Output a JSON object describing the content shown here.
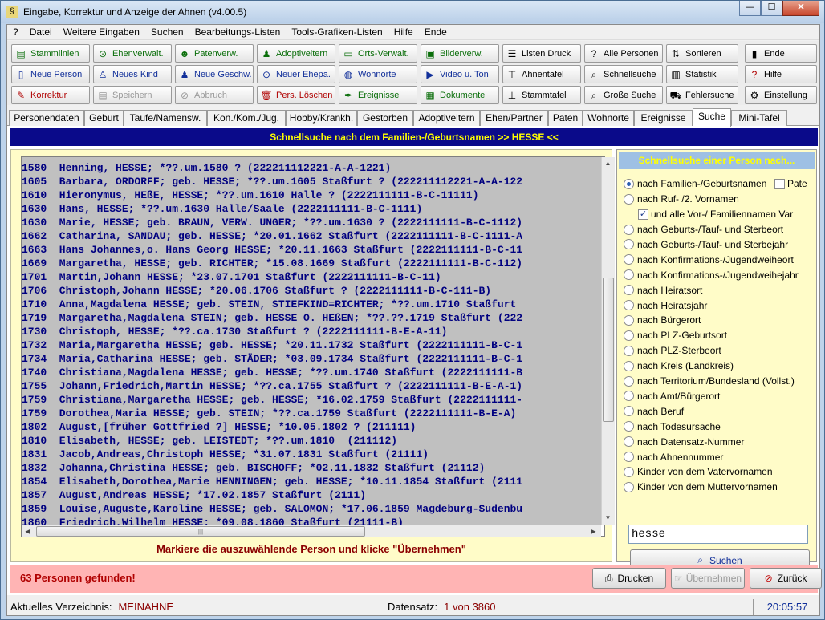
{
  "window": {
    "title": "Eingabe, Korrektur und Anzeige der Ahnen (v4.00.5)",
    "minimize": "—",
    "maximize": "☐",
    "close": "✕"
  },
  "menu": [
    "?",
    "Datei",
    "Weitere Eingaben",
    "Suchen",
    "Bearbeitungs-Listen",
    "Tools-Grafiken-Listen",
    "Hilfe",
    "Ende"
  ],
  "toolbar": {
    "stammlinien": "Stammlinien",
    "ehenverwalt": "Ehenverwalt.",
    "patenverw": "Patenverw.",
    "adoptiveltern": "Adoptiveltern",
    "ortsverwalt": "Orts-Verwalt.",
    "bilderverw": "Bilderverw.",
    "listendruck": "Listen Druck",
    "allepersonen": "Alle Personen",
    "sortieren": "Sortieren",
    "ende": "Ende",
    "neueperson": "Neue Person",
    "neueskind": "Neues Kind",
    "neuegeschw": "Neue Geschw.",
    "neuerehepa": "Neuer Ehepa.",
    "wohnorte": "Wohnorte",
    "videoton": "Video u. Ton",
    "ahnentafel": "Ahnentafel",
    "schnellsuche": "Schnellsuche",
    "statistik": "Statistik",
    "hilfe": "Hilfe",
    "korrektur": "Korrektur",
    "speichern": "Speichern",
    "abbruch": "Abbruch",
    "perslöschen": "Pers.  Löschen",
    "ereignisse": "Ereignisse",
    "dokumente": "Dokumente",
    "stammtafel": "Stammtafel",
    "grossesuche": "Große Suche",
    "fehlersuche": "Fehlersuche",
    "einstellung": "Einstellung"
  },
  "tabs": [
    "Personendaten",
    "Geburt",
    "Taufe/Namensw.",
    "Kon./Kom./Jug.",
    "Hobby/Krankh.",
    "Gestorben",
    "Adoptiveltern",
    "Ehen/Partner",
    "Paten",
    "Wohnorte",
    "Ereignisse",
    "Suche",
    "Mini-Tafel"
  ],
  "banner": "Schnellsuche nach dem Familien-/Geburtsnamen  >> HESSE <<",
  "results": [
    "1580  Henning, HESSE; *??.um.1580 ? (222211112221-A-A-1221)",
    "1605  Barbara, ORDORFF; geb. HESSE; *??.um.1605 Staßfurt ? (222211112221-A-A-122",
    "1610  Hieronymus, HEßE, HESSE; *??.um.1610 Halle ? (2222111111-B-C-11111)",
    "1630  Hans, HESSE; *??.um.1630 Halle/Saale (2222111111-B-C-1111)",
    "1630  Marie, HESSE; geb. BRAUN, VERW. UNGER; *??.um.1630 ? (2222111111-B-C-1112)",
    "1662  Catharina, SANDAU; geb. HESSE; *20.01.1662 Staßfurt (2222111111-B-C-1111-A",
    "1663  Hans Johannes,o. Hans Georg HESSE; *20.11.1663 Staßfurt (2222111111-B-C-11",
    "1669  Margaretha, HESSE; geb. RICHTER; *15.08.1669 Staßfurt (2222111111-B-C-112)",
    "1701  Martin,Johann HESSE; *23.07.1701 Staßfurt (2222111111-B-C-11)",
    "1706  Christoph,Johann HESSE; *20.06.1706 Staßfurt ? (2222111111-B-C-111-B)",
    "1710  Anna,Magdalena HESSE; geb. STEIN, STIEFKIND=RICHTER; *??.um.1710 Staßfurt",
    "1719  Margaretha,Magdalena STEIN; geb. HESSE O. HEßEN; *??.??.1719 Staßfurt (222",
    "1730  Christoph, HESSE; *??.ca.1730 Staßfurt ? (2222111111-B-E-A-11)",
    "1732  Maria,Margaretha HESSE; geb. HESSE; *20.11.1732 Staßfurt (2222111111-B-C-1",
    "1734  Maria,Catharina HESSE; geb. STÄDER; *03.09.1734 Staßfurt (2222111111-B-C-1",
    "1740  Christiana,Magdalena HESSE; geb. HESSE; *??.um.1740 Staßfurt (2222111111-B",
    "1755  Johann,Friedrich,Martin HESSE; *??.ca.1755 Staßfurt ? (2222111111-B-E-A-1)",
    "1759  Christiana,Margaretha HESSE; geb. HESSE; *16.02.1759 Staßfurt (2222111111-",
    "1759  Dorothea,Maria HESSE; geb. STEIN; *??.ca.1759 Staßfurt (2222111111-B-E-A)",
    "1802  August,[früher Gottfried ?] HESSE; *10.05.1802 ? (211111)",
    "1810  Elisabeth, HESSE; geb. LEISTEDT; *??.um.1810  (211112)",
    "1831  Jacob,Andreas,Christoph HESSE; *31.07.1831 Staßfurt (21111)",
    "1832  Johanna,Christina HESSE; geb. BISCHOFF; *02.11.1832 Staßfurt (21112)",
    "1854  Elisabeth,Dorothea,Marie HENNINGEN; geb. HESSE; *10.11.1854 Staßfurt (2111",
    "1857  August,Andreas HESSE; *17.02.1857 Staßfurt (2111)",
    "1859  Louise,Auguste,Karoline HESSE; geb. SALOMON; *17.06.1859 Magdeburg-Sudenbu",
    "1860  Friedrich,Wilhelm HESSE; *09.08.1860 Staßfurt (21111-B)"
  ],
  "hint": "Markiere die auszuwählende Person und klicke \"Übernehmen\"",
  "search_panel": {
    "title": "Schnellsuche einer Person nach...",
    "pate_label": "Pate",
    "all_names_label": "und alle Vor-/ Familiennamen Var",
    "options": [
      "nach Familien-/Geburtsnamen",
      "nach Ruf- /2. Vornamen",
      "nach Geburts-/Tauf- und Sterbeort",
      "nach Geburts-/Tauf- und Sterbejahr",
      "nach Konfirmations-/Jugendweiheort",
      "nach Konfirmations-/Jugendweihejahr",
      "nach Heiratsort",
      "nach Heiratsjahr",
      "nach Bürgerort",
      "nach PLZ-Geburtsort",
      "nach PLZ-Sterbeort",
      "nach Kreis (Landkreis)",
      "nach Territorium/Bundesland (Vollst.)",
      "nach Amt/Bürgerort",
      "nach Beruf",
      "nach Todesursache",
      "nach Datensatz-Nummer",
      "nach Ahnennummer",
      "Kinder von dem Vatervornamen",
      "Kinder von dem Muttervornamen"
    ],
    "search_value": "hesse",
    "search_button": "Suchen"
  },
  "footer": {
    "found": "63 Personen gefunden!",
    "print": "Drucken",
    "accept": "Übernehmen",
    "back": "Zurück"
  },
  "status": {
    "dir_label": "Aktuelles Verzeichnis:",
    "dir_value": "MEINAHNE",
    "record_label": "Datensatz:",
    "record_value": "1 von 3860",
    "time": "20:05:57"
  }
}
